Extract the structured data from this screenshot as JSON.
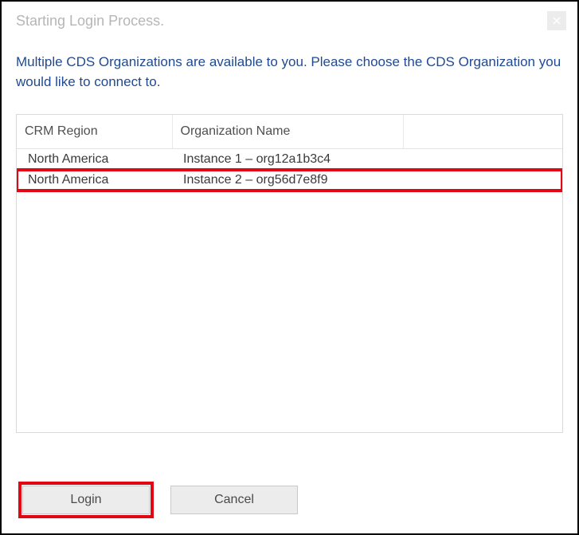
{
  "titlebar": {
    "title": "Starting Login Process."
  },
  "instruction": "Multiple CDS Organizations are available to you. Please choose the CDS Organization you would like to connect to.",
  "grid": {
    "headers": {
      "region": "CRM Region",
      "org": "Organization Name",
      "empty": ""
    },
    "rows": [
      {
        "region": "North America",
        "org": "Instance 1 – org12a1b3c4",
        "highlighted": false
      },
      {
        "region": "North America",
        "org": "Instance 2 – org56d7e8f9",
        "highlighted": true
      }
    ]
  },
  "buttons": {
    "login": "Login",
    "cancel": "Cancel"
  }
}
